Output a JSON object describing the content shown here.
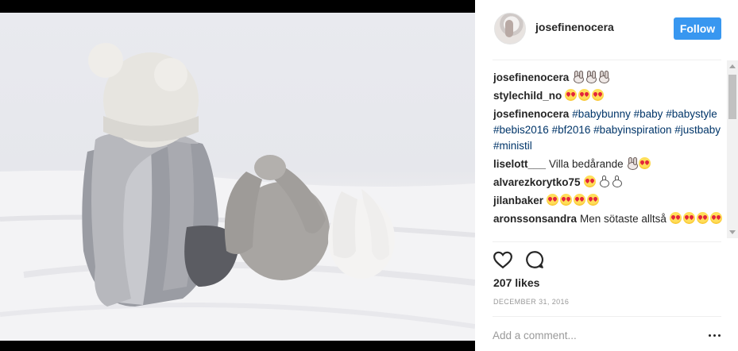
{
  "post": {
    "username": "josefinenocera",
    "follow_label": "Follow",
    "likes": "207 likes",
    "date": "DECEMBER 31, 2016",
    "add_comment_placeholder": "Add a comment...",
    "accent_color": "#3897f0",
    "hashtag_color": "#003569"
  },
  "icons": {
    "like": "heart-outline-icon",
    "comment": "speech-bubble-icon",
    "more": "more-options-icon",
    "emoji_love": "heart-eyes-emoji",
    "emoji_bunny": "bunny-face-emoji",
    "emoji_rabbit": "rabbit-emoji"
  },
  "comments": [
    {
      "user": "josefinenocera",
      "text": "",
      "emoji": [
        "bunny",
        "bunny",
        "bunny"
      ]
    },
    {
      "user": "stylechild_no",
      "text": "",
      "emoji": [
        "love",
        "love",
        "love"
      ]
    },
    {
      "user": "josefinenocera",
      "text": "",
      "hashtags": [
        "#babybunny",
        "#baby",
        "#babystyle",
        "#bebis2016",
        "#bf2016",
        "#babyinspiration",
        "#justbaby",
        "#ministil"
      ]
    },
    {
      "user": "liselott___",
      "text": "Villa bedårande",
      "emoji": [
        "bunny",
        "love"
      ]
    },
    {
      "user": "alvarezkorytko75",
      "text": "",
      "emoji": [
        "love",
        "rabbit",
        "rabbit"
      ]
    },
    {
      "user": "jilanbaker",
      "text": "",
      "emoji": [
        "love",
        "love",
        "love",
        "love"
      ]
    },
    {
      "user": "aronssonsandra",
      "text": "Men sötaste alltså",
      "emoji": [
        "love",
        "love",
        "love",
        "love"
      ]
    }
  ]
}
